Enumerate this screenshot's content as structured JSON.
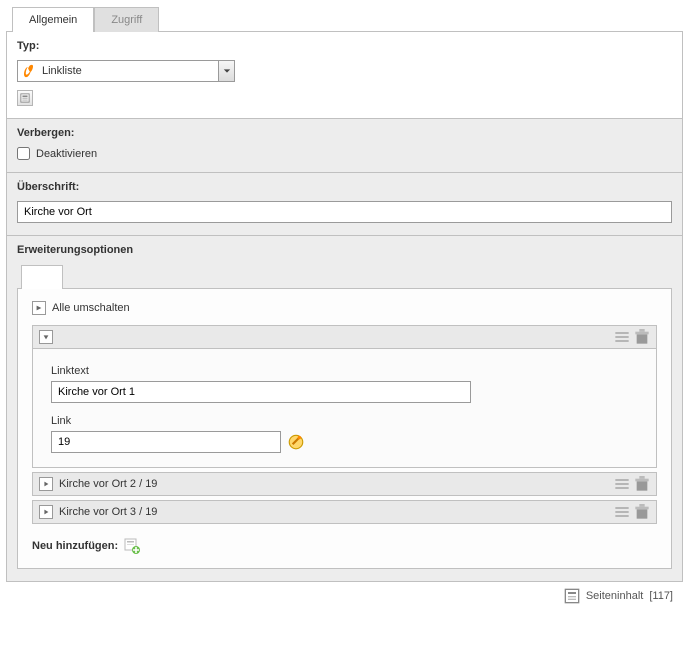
{
  "tabs": {
    "general": "Allgemein",
    "access": "Zugriff"
  },
  "typ": {
    "label": "Typ:",
    "selected": "Linkliste"
  },
  "hide": {
    "label": "Verbergen:",
    "checkbox_label": "Deaktivieren",
    "checked": false
  },
  "headline": {
    "label": "Überschrift:",
    "value": "Kirche vor Ort"
  },
  "ext": {
    "label": "Erweiterungsoptionen",
    "toggle_all": "Alle umschalten",
    "fields": {
      "linktext": "Linktext",
      "link": "Link"
    },
    "items": [
      {
        "linktext": "Kirche vor Ort 1",
        "link": "19",
        "expanded": true
      },
      {
        "summary": "Kirche vor Ort 2 / 19",
        "expanded": false
      },
      {
        "summary": "Kirche vor Ort 3 / 19",
        "expanded": false
      }
    ],
    "add_new": "Neu hinzufügen:"
  },
  "footer": {
    "label": "Seiteninhalt",
    "id": "[117]"
  }
}
